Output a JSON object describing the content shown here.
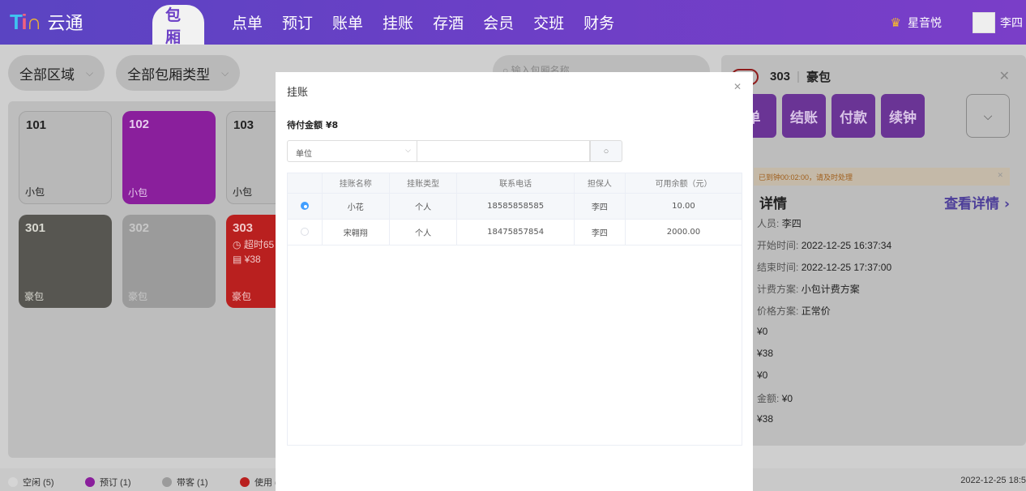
{
  "logo": {
    "mark_t": "T",
    "mark_i": "i",
    "mark_n": "∩",
    "brand": "云通"
  },
  "nav": {
    "active": "包厢",
    "tabs": [
      "点单",
      "预订",
      "账单",
      "挂账",
      "存酒",
      "会员",
      "交班",
      "财务"
    ]
  },
  "user": {
    "shop": "星音悦",
    "name": "李四"
  },
  "filters": {
    "area": "全部区域",
    "room_type": "全部包厢类型",
    "search_placeholder": "输入包厢名称"
  },
  "rooms": [
    {
      "num": "101",
      "type": "小包"
    },
    {
      "num": "102",
      "type": "小包"
    },
    {
      "num": "103",
      "type": "小包"
    },
    {
      "num": "301",
      "type": "豪包"
    },
    {
      "num": "302",
      "type": "豪包"
    },
    {
      "num": "303",
      "type": "豪包",
      "overtime": "超时65",
      "amount": "¥38"
    }
  ],
  "detail": {
    "room_num": "303",
    "room_type": "豪包",
    "actions": [
      "单",
      "结账",
      "付款",
      "续钟"
    ],
    "notice": "已到钟00:02:00，请及时处理",
    "title": "详情",
    "link": "查看详情",
    "rows": [
      {
        "k": "人员:",
        "v": "李四"
      },
      {
        "k": "开始时间:",
        "v": "2022-12-25 16:37:34"
      },
      {
        "k": "结束时间:",
        "v": "2022-12-25 17:37:00"
      },
      {
        "k": "计费方案:",
        "v": "小包计费方案"
      },
      {
        "k": "价格方案:",
        "v": "正常价"
      },
      {
        "k": "",
        "v": "¥0"
      },
      {
        "k": "",
        "v": "¥38"
      },
      {
        "k": "",
        "v": "¥0"
      },
      {
        "k": "金额:",
        "v": "¥0"
      },
      {
        "k": "",
        "v": "¥38"
      }
    ]
  },
  "legend": [
    {
      "label": "空闲 (5)",
      "color": "#d5d5d5"
    },
    {
      "label": "预订 (1)",
      "color": "#8a1f9c"
    },
    {
      "label": "带客 (1)",
      "color": "#9b9b9b"
    },
    {
      "label": "使用 (",
      "color": "#b9201f"
    }
  ],
  "clock": "2022-12-25 18:5",
  "modal": {
    "title": "挂账",
    "pay_label": "待付金额 ¥8",
    "unit_select": "单位",
    "search_value": "",
    "columns": [
      "挂账名称",
      "挂账类型",
      "联系电话",
      "担保人",
      "可用余额（元）"
    ],
    "rows": [
      {
        "name": "小花",
        "type": "个人",
        "phone": "18585858585",
        "guarantor": "李四",
        "balance": "10.00",
        "selected": true
      },
      {
        "name": "宋翱翔",
        "type": "个人",
        "phone": "18475857854",
        "guarantor": "李四",
        "balance": "2000.00",
        "selected": false
      }
    ]
  }
}
